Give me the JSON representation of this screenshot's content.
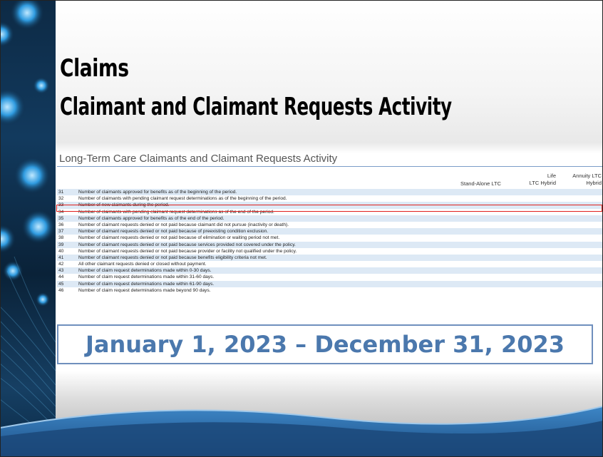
{
  "title": {
    "line1": "Claims",
    "line2": "Claimant and Claimant Requests Activity"
  },
  "table": {
    "heading": "Long-Term Care Claimants and Claimant Requests Activity",
    "columns": [
      "Stand-Alone LTC",
      "Life\nLTC Hybrid",
      "Annuity LTC\nHybrid"
    ],
    "rows": [
      {
        "num": "31",
        "text": "Number of claimants approved for benefits as of the beginning of the period."
      },
      {
        "num": "32",
        "text": "Number of claimants with pending claimant request determinations as of the beginning of the period."
      },
      {
        "num": "33",
        "text": "Number of new claimants during the period."
      },
      {
        "num": "34",
        "text": "Number of claimants with pending claimant request determinations as of the end of the period."
      },
      {
        "num": "35",
        "text": "Number of claimants approved for benefits as of the end of the period."
      },
      {
        "num": "36",
        "text": "Number of claimant requests denied or not paid because claimant did not pursue (inactivity or death)."
      },
      {
        "num": "37",
        "text": "Number of claimant requests denied or not paid because of preexisting condition exclusion."
      },
      {
        "num": "38",
        "text": "Number of claimant requests denied or not paid because of elimination or waiting period not met."
      },
      {
        "num": "39",
        "text": "Number of claimant requests denied or not paid because services provided not covered under the policy."
      },
      {
        "num": "40",
        "text": "Number of claimant requests denied or not paid because provider or facility not qualified under the policy."
      },
      {
        "num": "41",
        "text": "Number of claimant requests denied or not paid because benefits eligibility criteria not met."
      },
      {
        "num": "42",
        "text": "All other claimant requests denied or closed without payment."
      },
      {
        "num": "43",
        "text": "Number of claim request determinations made within 0-30 days."
      },
      {
        "num": "44",
        "text": "Number of claim request determinations made within 31-60 days."
      },
      {
        "num": "45",
        "text": "Number of claim request determinations made within 61-90 days."
      },
      {
        "num": "46",
        "text": "Number of claim request determinations made beyond 90 days."
      }
    ],
    "highlighted_row": "33"
  },
  "date_range": "January 1, 2023 – December 31, 2023",
  "colors": {
    "highlight": "#e0201d",
    "date_text": "#4b78ad",
    "row_alt": "#dde9f5",
    "side_panel": "#123a5e"
  }
}
